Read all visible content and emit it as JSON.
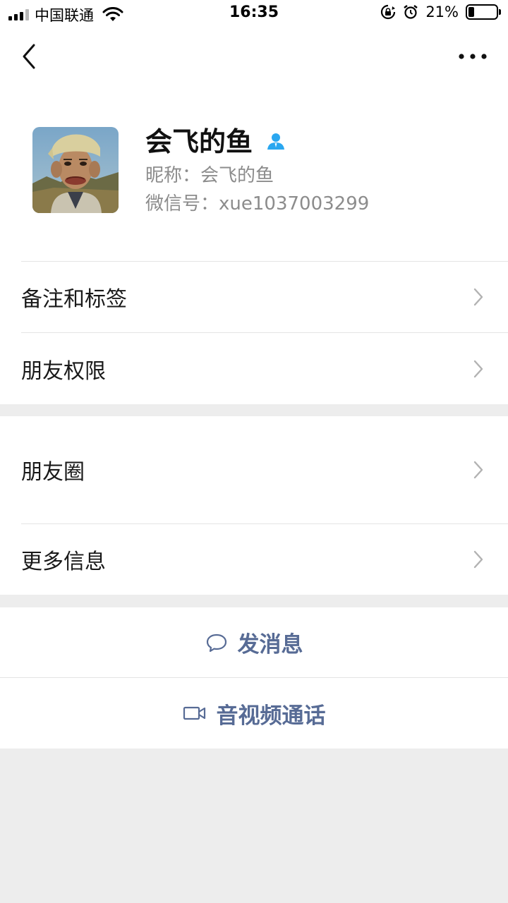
{
  "status_bar": {
    "carrier": "中国联通",
    "time": "16:35",
    "battery": "21%",
    "battery_level": 0.21
  },
  "navbar": {
    "back_icon": "chevron-left-icon",
    "more_icon": "more-dots-icon"
  },
  "profile": {
    "name": "会飞的鱼",
    "nickname": "昵称：会飞的鱼",
    "wechat_id": "微信号：xue1037003299",
    "contact_icon": "person-icon"
  },
  "section1": {
    "items": [
      {
        "label": "备注和标签"
      },
      {
        "label": "朋友权限"
      }
    ]
  },
  "section2": {
    "items": [
      {
        "label": "朋友圈"
      },
      {
        "label": "更多信息"
      }
    ]
  },
  "actions": {
    "message": "发消息",
    "call": "音视频通话"
  },
  "colors": {
    "link": "#576b95",
    "background": "#ededed",
    "contact_icon": "#2aa7f0"
  }
}
